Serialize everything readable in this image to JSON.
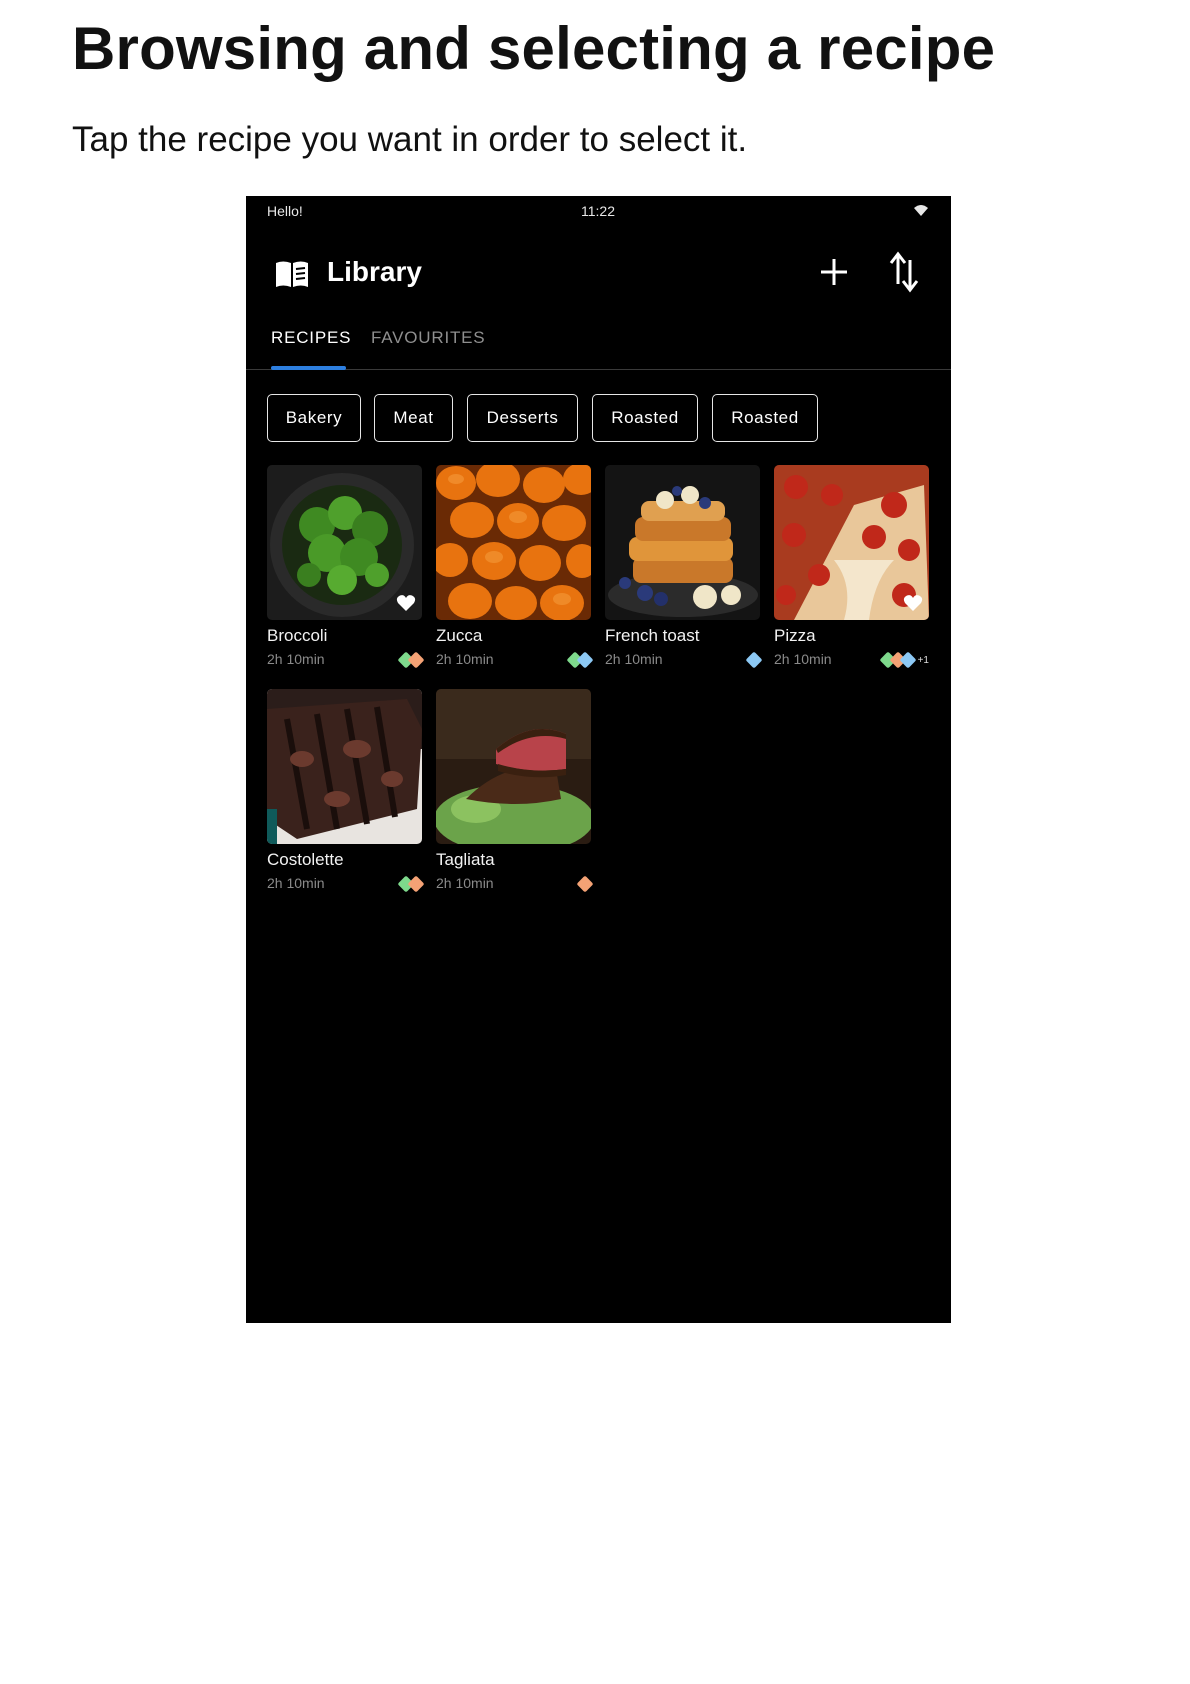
{
  "doc": {
    "title": "Browsing and selecting a recipe",
    "subtitle": "Tap the recipe you want in order to select it."
  },
  "status": {
    "left": "Hello!",
    "time": "11:22",
    "wifi_icon": "wifi-icon"
  },
  "appbar": {
    "title": "Library",
    "icon": "book-icon",
    "add_icon": "plus-icon",
    "sort_icon": "sort-icon"
  },
  "tabs": [
    {
      "label": "RECIPES",
      "active": true
    },
    {
      "label": "FAVOURITES",
      "active": false
    }
  ],
  "chips": [
    "Bakery",
    "Meat",
    "Desserts",
    "Roasted",
    "Roasted"
  ],
  "tag_colors": {
    "green": "#7ed98c",
    "orange": "#f4a275",
    "blue": "#8cc8f4"
  },
  "accent": "#2d7fe0",
  "recipes": [
    {
      "name": "Broccoli",
      "time": "2h 10min",
      "favourite": true,
      "tags": [
        "green",
        "orange"
      ],
      "more": ""
    },
    {
      "name": "Zucca",
      "time": "2h 10min",
      "favourite": false,
      "tags": [
        "green",
        "blue"
      ],
      "more": ""
    },
    {
      "name": "French toast",
      "time": "2h 10min",
      "favourite": false,
      "tags": [
        "blue"
      ],
      "more": ""
    },
    {
      "name": "Pizza",
      "time": "2h 10min",
      "favourite": true,
      "tags": [
        "green",
        "orange",
        "blue"
      ],
      "more": "+1"
    },
    {
      "name": "Costolette",
      "time": "2h 10min",
      "favourite": false,
      "tags": [
        "green",
        "orange"
      ],
      "more": ""
    },
    {
      "name": "Tagliata",
      "time": "2h 10min",
      "favourite": false,
      "tags": [
        "orange"
      ],
      "more": ""
    }
  ]
}
